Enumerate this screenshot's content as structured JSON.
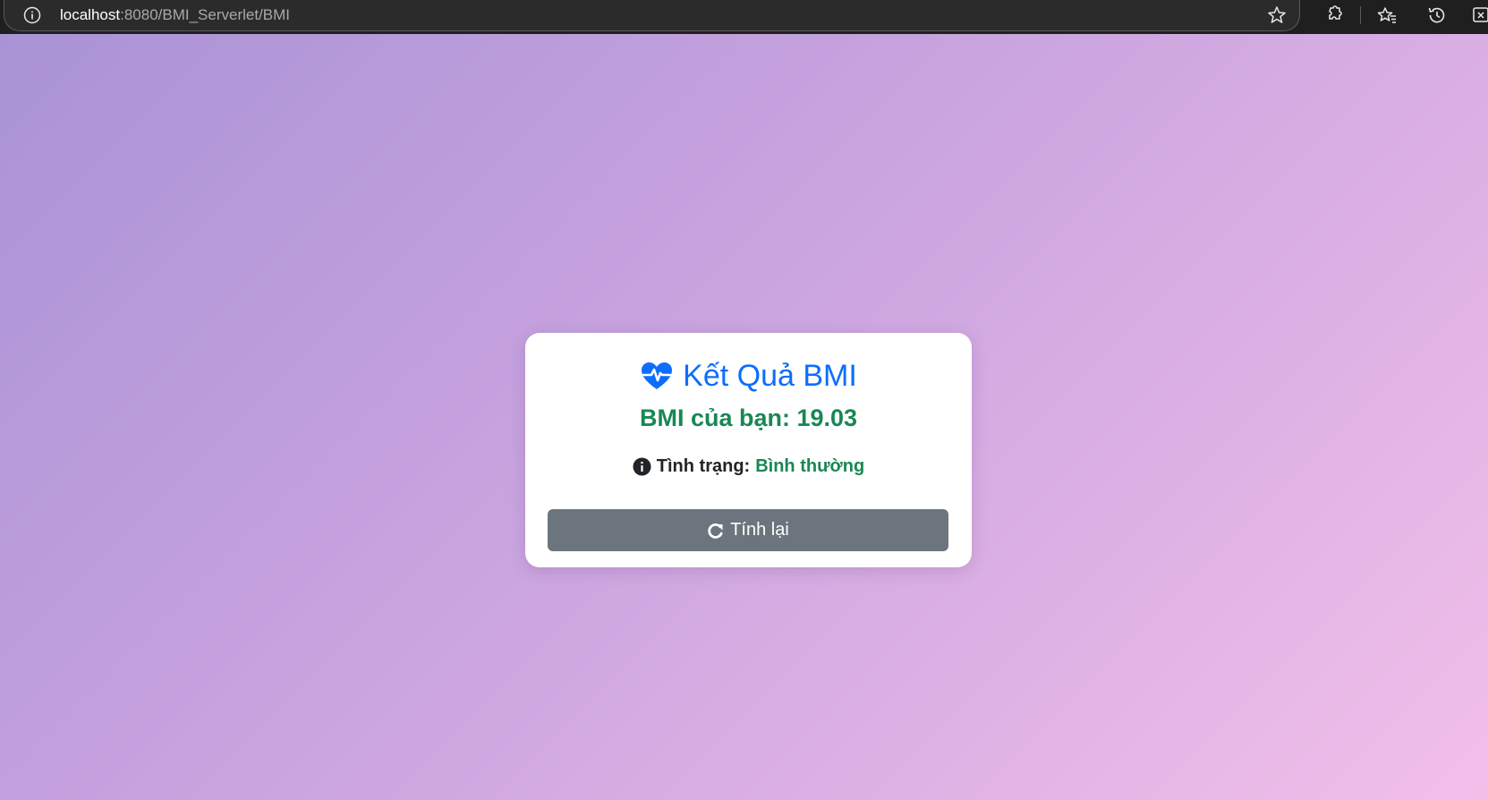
{
  "browser": {
    "url_host": "localhost",
    "url_path": ":8080/BMI_Serverlet/BMI",
    "icons": [
      "info-icon",
      "star-icon",
      "extensions-icon",
      "favorites-icon",
      "history-icon",
      "split-screen-icon"
    ]
  },
  "card": {
    "title": "Kết Quả BMI",
    "bmi_label": "BMI của bạn: 19.03",
    "status_label": "Tình trạng:",
    "status_value": "Bình thường",
    "button_label": "Tính lại"
  },
  "colors": {
    "title": "#0d6efd",
    "success": "#198754",
    "button": "#6c757d",
    "background_start": "#a993d6",
    "background_end": "#f2bfe9"
  }
}
